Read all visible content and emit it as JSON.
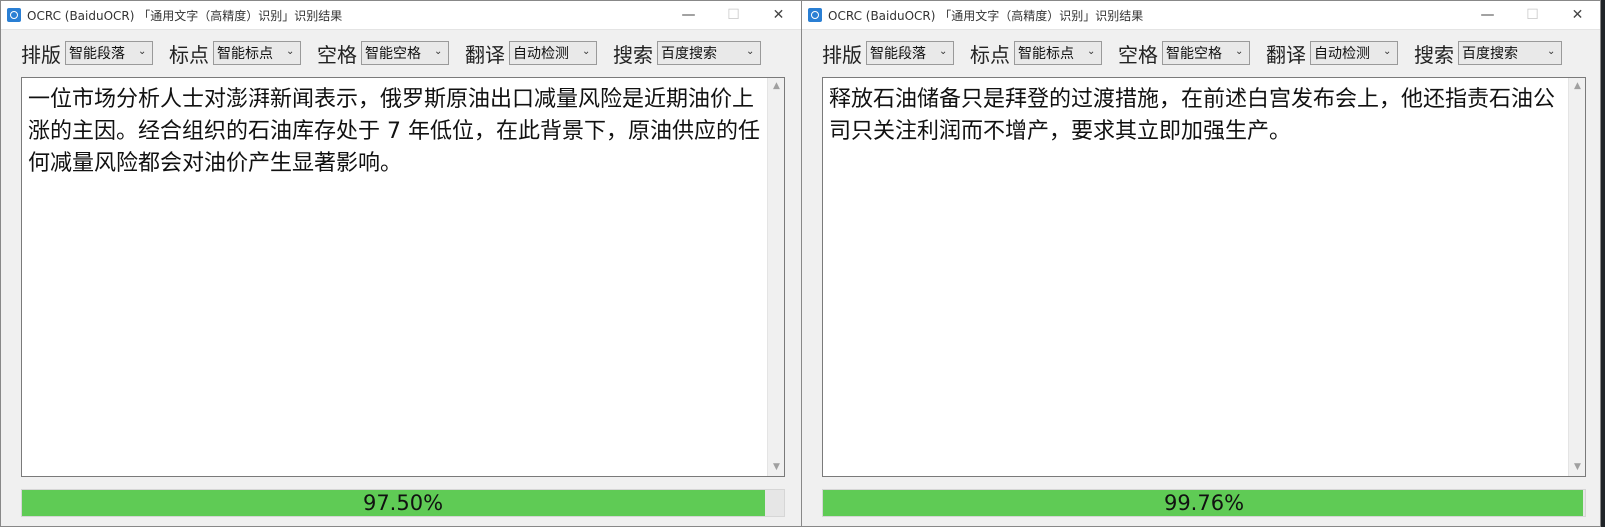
{
  "windows": [
    {
      "title": "OCRC (BaiduOCR) 「通用文字（高精度）识别」识别结果",
      "toolbar": [
        {
          "label": "排版",
          "value": "智能段落"
        },
        {
          "label": "标点",
          "value": "智能标点"
        },
        {
          "label": "空格",
          "value": "智能空格"
        },
        {
          "label": "翻译",
          "value": "自动检测"
        },
        {
          "label": "搜索",
          "value": "百度搜索"
        }
      ],
      "text": "一位市场分析人士对澎湃新闻表示，俄罗斯原油出口减量风险是近期油价上涨的主因。经合组织的石油库存处于 7 年低位，在此背景下，原油供应的任何减量风险都会对油价产生显著影响。",
      "confidence": "97.50%",
      "confidence_value": 97.5
    },
    {
      "title": "OCRC (BaiduOCR) 「通用文字（高精度）识别」识别结果",
      "toolbar": [
        {
          "label": "排版",
          "value": "智能段落"
        },
        {
          "label": "标点",
          "value": "智能标点"
        },
        {
          "label": "空格",
          "value": "智能空格"
        },
        {
          "label": "翻译",
          "value": "自动检测"
        },
        {
          "label": "搜索",
          "value": "百度搜索"
        }
      ],
      "text": "释放石油储备只是拜登的过渡措施，在前述白宫发布会上，他还指责石油公司只关注利润而不增产，要求其立即加强生产。",
      "confidence": "99.76%",
      "confidence_value": 99.76
    }
  ],
  "icons": {
    "minimize": "minimize-icon",
    "maximize": "maximize-icon",
    "close": "close-icon",
    "app": "app-icon",
    "dropdown": "chevron-down-icon"
  },
  "colors": {
    "progress": "#5fcb55",
    "titlebar": "#ffffff",
    "window_bg": "#f0f0f0"
  }
}
